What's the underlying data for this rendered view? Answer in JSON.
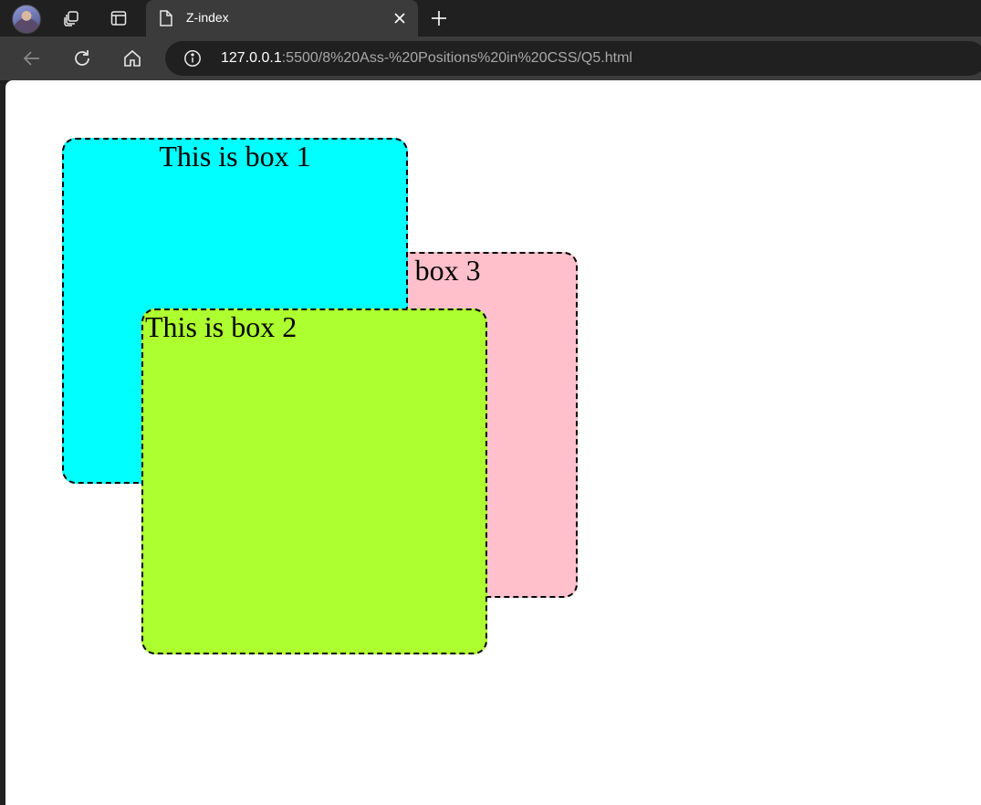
{
  "tab": {
    "title": "Z-index"
  },
  "address_bar": {
    "url_host": "127.0.0.1",
    "url_rest": ":5500/8%20Ass-%20Positions%20in%20CSS/Q5.html"
  },
  "page": {
    "boxes": [
      {
        "label": "This is box 1",
        "color": "#00ffff"
      },
      {
        "label": "This is box 2",
        "color": "#adff2f"
      },
      {
        "label": "This is box 3",
        "color": "#ffc0cb"
      }
    ]
  },
  "icons": {
    "profile": "avatar",
    "workspaces": "workspaces-icon",
    "tab_actions": "tab-actions-icon",
    "tab_page": "page-icon",
    "tab_close": "close-icon",
    "new_tab": "plus-icon",
    "back": "back-arrow-icon",
    "reload": "reload-icon",
    "home": "home-icon",
    "site_info": "info-icon"
  }
}
